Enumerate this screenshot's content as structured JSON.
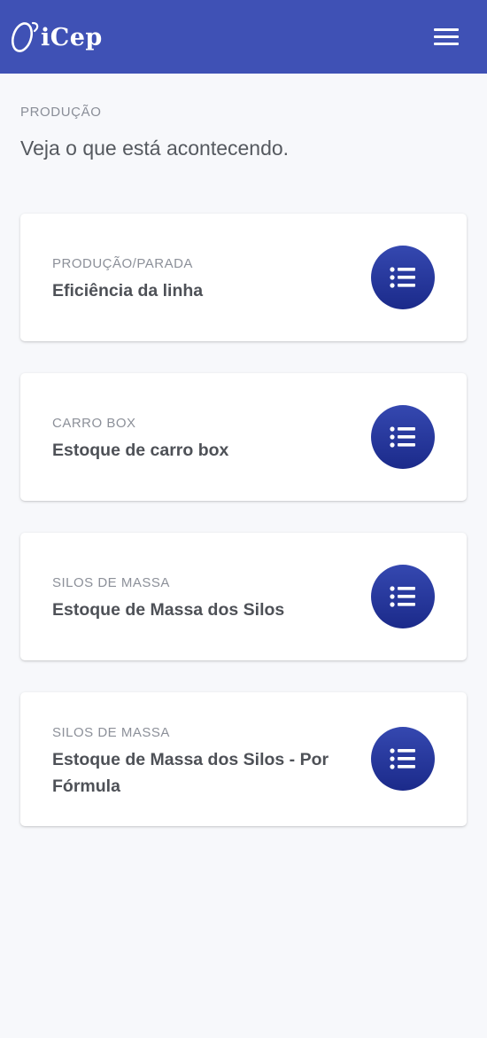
{
  "app": {
    "brand": "iCep",
    "colors": {
      "header": "#3f51b5",
      "accent": "#2a3a9e",
      "background": "#f7f8fb"
    }
  },
  "header": {
    "menu_icon": "hamburger-menu-icon"
  },
  "intro": {
    "kicker": "PRODUÇÃO",
    "title": "Veja o que está acontecendo."
  },
  "cards": [
    {
      "kicker": "PRODUÇÃO/PARADA",
      "title": "Eficiência da linha",
      "icon": "list-icon"
    },
    {
      "kicker": "CARRO BOX",
      "title": "Estoque de carro box",
      "icon": "list-icon"
    },
    {
      "kicker": "SILOS DE MASSA",
      "title": "Estoque de Massa dos Silos",
      "icon": "list-icon"
    },
    {
      "kicker": "SILOS DE MASSA",
      "title": "Estoque de Massa dos Silos - Por Fórmula",
      "icon": "list-icon"
    }
  ]
}
